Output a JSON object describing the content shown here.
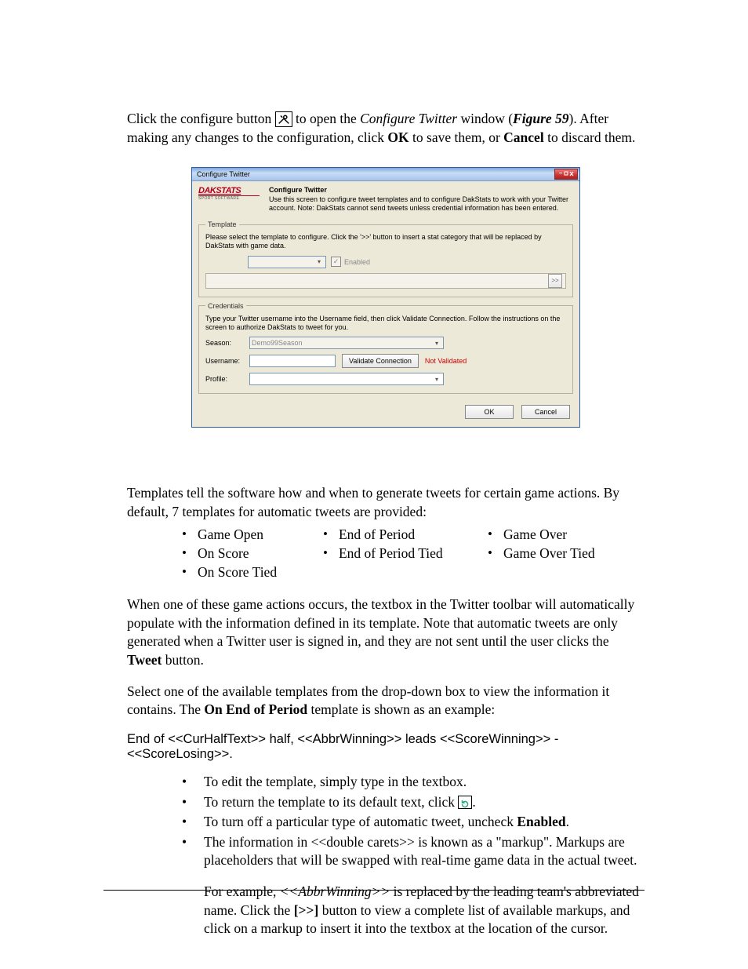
{
  "intro": {
    "line1a": "Click the configure button ",
    "line1b": " to open the ",
    "win_name": "Configure Twitter",
    "line1c": " window (",
    "fig": "Figure 59",
    "line1d": "). After making any changes to the configuration, click ",
    "ok": "OK",
    "line1e": " to save them, or ",
    "cancel": "Cancel",
    "line1f": " to discard them."
  },
  "win": {
    "title": "Configure Twitter",
    "header_title": "Configure Twitter",
    "header_desc": "Use this screen to configure tweet templates and to configure DakStats to work with your Twitter account. Note: DakStats cannot send tweets unless credential information has been entered.",
    "logo_main": "DAKSTATS",
    "logo_sub": "SPORT SOFTWARE",
    "template": {
      "legend": "Template",
      "desc": "Please select the template to configure. Click the '>>' button to insert a stat category that will be replaced by DakStats with game data.",
      "enabled": "Enabled",
      "insert": ">>"
    },
    "cred": {
      "legend": "Credentials",
      "desc": "Type your Twitter username into the Username field, then click Validate Connection. Follow the instructions on the screen to authorize DakStats to tweet for you.",
      "season_label": "Season:",
      "season_value": "Demo99Season",
      "username_label": "Username:",
      "validate": "Validate Connection",
      "status": "Not Validated",
      "profile_label": "Profile:"
    },
    "ok": "OK",
    "cancel": "Cancel"
  },
  "templates_intro": "Templates tell the software how and when to generate tweets for certain game actions. By default, 7 templates for automatic tweets are provided:",
  "tpl_list": {
    "col1": [
      "Game Open",
      "On Score",
      "On Score Tied"
    ],
    "col2": [
      "End of Period",
      "End of Period Tied"
    ],
    "col3": [
      "Game Over",
      "Game Over Tied"
    ]
  },
  "para2a": "When one of these game actions occurs, the textbox in the Twitter toolbar will automatically populate with the information defined in its template. Note that automatic tweets are only generated when a Twitter user is signed in, and they are not sent until the user clicks the ",
  "para2_bold": "Tweet",
  "para2b": " button.",
  "para3a": "Select one of the available templates from the drop-down box to view the information it contains. The ",
  "para3_bold": "On End of Period",
  "para3b": " template is shown as an example:",
  "example": "End of <<CurHalfText>> half, <<AbbrWinning>> leads <<ScoreWinning>> - <<ScoreLosing>>.",
  "bullets": {
    "b1": "To edit the template, simply type in the textbox.",
    "b2a": "To return the template to its default text, click  ",
    "b2b": ".",
    "b3a": "To turn off a particular type of automatic tweet, uncheck ",
    "b3_bold": "Enabled",
    "b3b": ".",
    "b4": "The information in <<double carets>> is known as a \"markup\". Markups are placeholders that will be swapped with real-time game data in the actual tweet."
  },
  "final": {
    "a": "For example, ",
    "em": "<<AbbrWinning>>",
    "b": " is replaced by the leading team's abbreviated name. Click the ",
    "bold": "[>>]",
    "c": " button to view a complete list of available markups, and click on a markup to insert it into the textbox at the location of the cursor."
  }
}
